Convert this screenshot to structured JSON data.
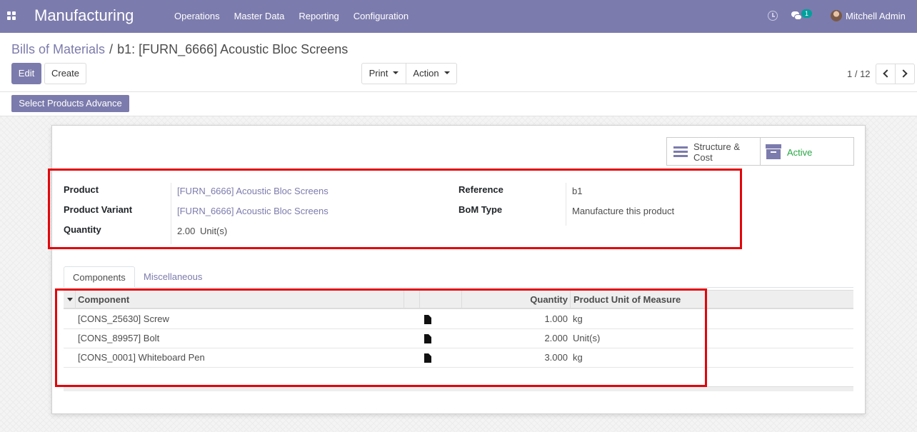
{
  "app": {
    "title": "Manufacturing"
  },
  "menu": {
    "items": [
      {
        "label": "Operations"
      },
      {
        "label": "Master Data"
      },
      {
        "label": "Reporting"
      },
      {
        "label": "Configuration"
      }
    ]
  },
  "systray": {
    "chat_count": "1",
    "user_name": "Mitchell Admin",
    "icons": [
      "apps-icon",
      "clock-icon",
      "chat-icon",
      "avatar"
    ]
  },
  "breadcrumb": {
    "parent": "Bills of Materials",
    "separator": "/",
    "current": "b1: [FURN_6666] Acoustic Bloc Screens"
  },
  "buttons": {
    "edit": "Edit",
    "create": "Create",
    "print": "Print",
    "action": "Action",
    "select_products": "Select Products Advance"
  },
  "pager": {
    "value": "1 / 12"
  },
  "smart_buttons": {
    "structure_cost": "Structure & Cost",
    "active": "Active"
  },
  "form": {
    "product_label": "Product",
    "product_value": "[FURN_6666] Acoustic Bloc Screens",
    "variant_label": "Product Variant",
    "variant_value": "[FURN_6666] Acoustic Bloc Screens",
    "quantity_label": "Quantity",
    "quantity_value": "2.00",
    "quantity_uom": "Unit(s)",
    "reference_label": "Reference",
    "reference_value": "b1",
    "bom_type_label": "BoM Type",
    "bom_type_value": "Manufacture this product"
  },
  "tabs": {
    "components": "Components",
    "misc": "Miscellaneous"
  },
  "table": {
    "headers": {
      "component": "Component",
      "quantity": "Quantity",
      "uom": "Product Unit of Measure"
    },
    "rows": [
      {
        "component": "[CONS_25630] Screw",
        "quantity": "1.000",
        "uom": "kg"
      },
      {
        "component": "[CONS_89957] Bolt",
        "quantity": "2.000",
        "uom": "Unit(s)"
      },
      {
        "component": "[CONS_0001] Whiteboard Pen",
        "quantity": "3.000",
        "uom": "kg"
      }
    ]
  },
  "colors": {
    "brand": "#7c7bad",
    "highlight": "#e3050b",
    "active": "#28a745"
  }
}
